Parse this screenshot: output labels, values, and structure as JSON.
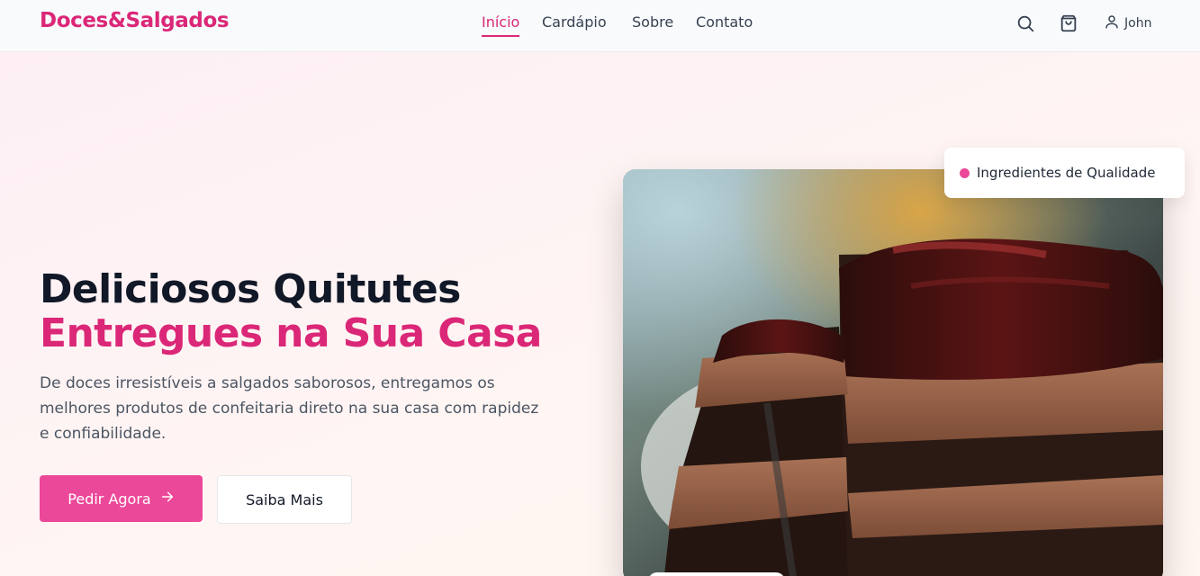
{
  "brand": {
    "name": "Doces&Salgados"
  },
  "nav": {
    "links": [
      {
        "label": "Início",
        "active": true
      },
      {
        "label": "Cardápio",
        "active": false
      },
      {
        "label": "Sobre",
        "active": false
      },
      {
        "label": "Contato",
        "active": false
      }
    ],
    "icons": [
      "search-icon",
      "cart-icon",
      "user-icon"
    ],
    "user_name": "John"
  },
  "hero": {
    "title_line1": "Deliciosos Quitutes",
    "title_line2": "Entregues na Sua Casa",
    "description": "De doces irresistíveis a salgados saborosos, entregamos os melhores produtos de confeitaria direto na sua casa com rapidez e confiabilidade.",
    "primary_button": "Pedir Agora",
    "secondary_button": "Saiba Mais",
    "badge": "Ingredientes de Qualidade"
  },
  "colors": {
    "brand": "#db2777",
    "button": "#ec4899",
    "heading": "#111827",
    "text": "#4b5563"
  }
}
